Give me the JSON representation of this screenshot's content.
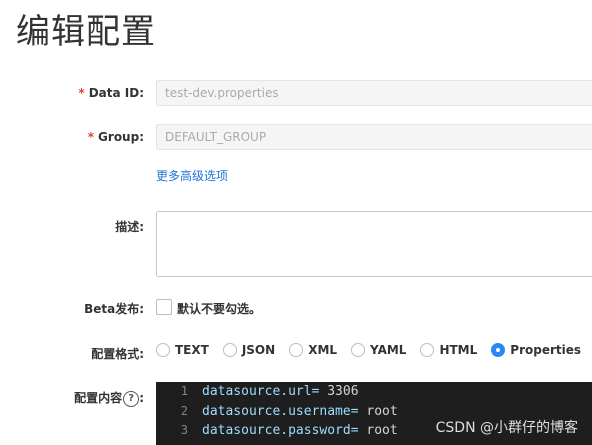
{
  "page": {
    "title": "编辑配置"
  },
  "form": {
    "data_id": {
      "label": "Data ID:",
      "value": "test-dev.properties",
      "required": true
    },
    "group": {
      "label": "Group:",
      "value": "DEFAULT_GROUP",
      "required": true
    },
    "advanced_link": "更多高级选项",
    "description": {
      "label": "描述:",
      "value": ""
    },
    "beta": {
      "label": "Beta发布:",
      "checkbox_text": "默认不要勾选。",
      "checked": false
    },
    "format": {
      "label": "配置格式:",
      "options": [
        "TEXT",
        "JSON",
        "XML",
        "YAML",
        "HTML",
        "Properties"
      ],
      "selected": "Properties"
    },
    "content": {
      "label": "配置内容",
      "help_icon": "question-circle-icon",
      "lines": [
        {
          "num": "1",
          "key": "datasource.url=",
          "value": " 3306"
        },
        {
          "num": "2",
          "key": "datasource.username=",
          "value": " root"
        },
        {
          "num": "3",
          "key": "datasource.password=",
          "value": " root"
        }
      ]
    }
  },
  "watermark": "CSDN @小群仔的博客",
  "colors": {
    "required": "#e0423a",
    "link": "#1f73d9",
    "radio_checked": "#2b86f6",
    "editor_bg": "#1e1e1e"
  }
}
